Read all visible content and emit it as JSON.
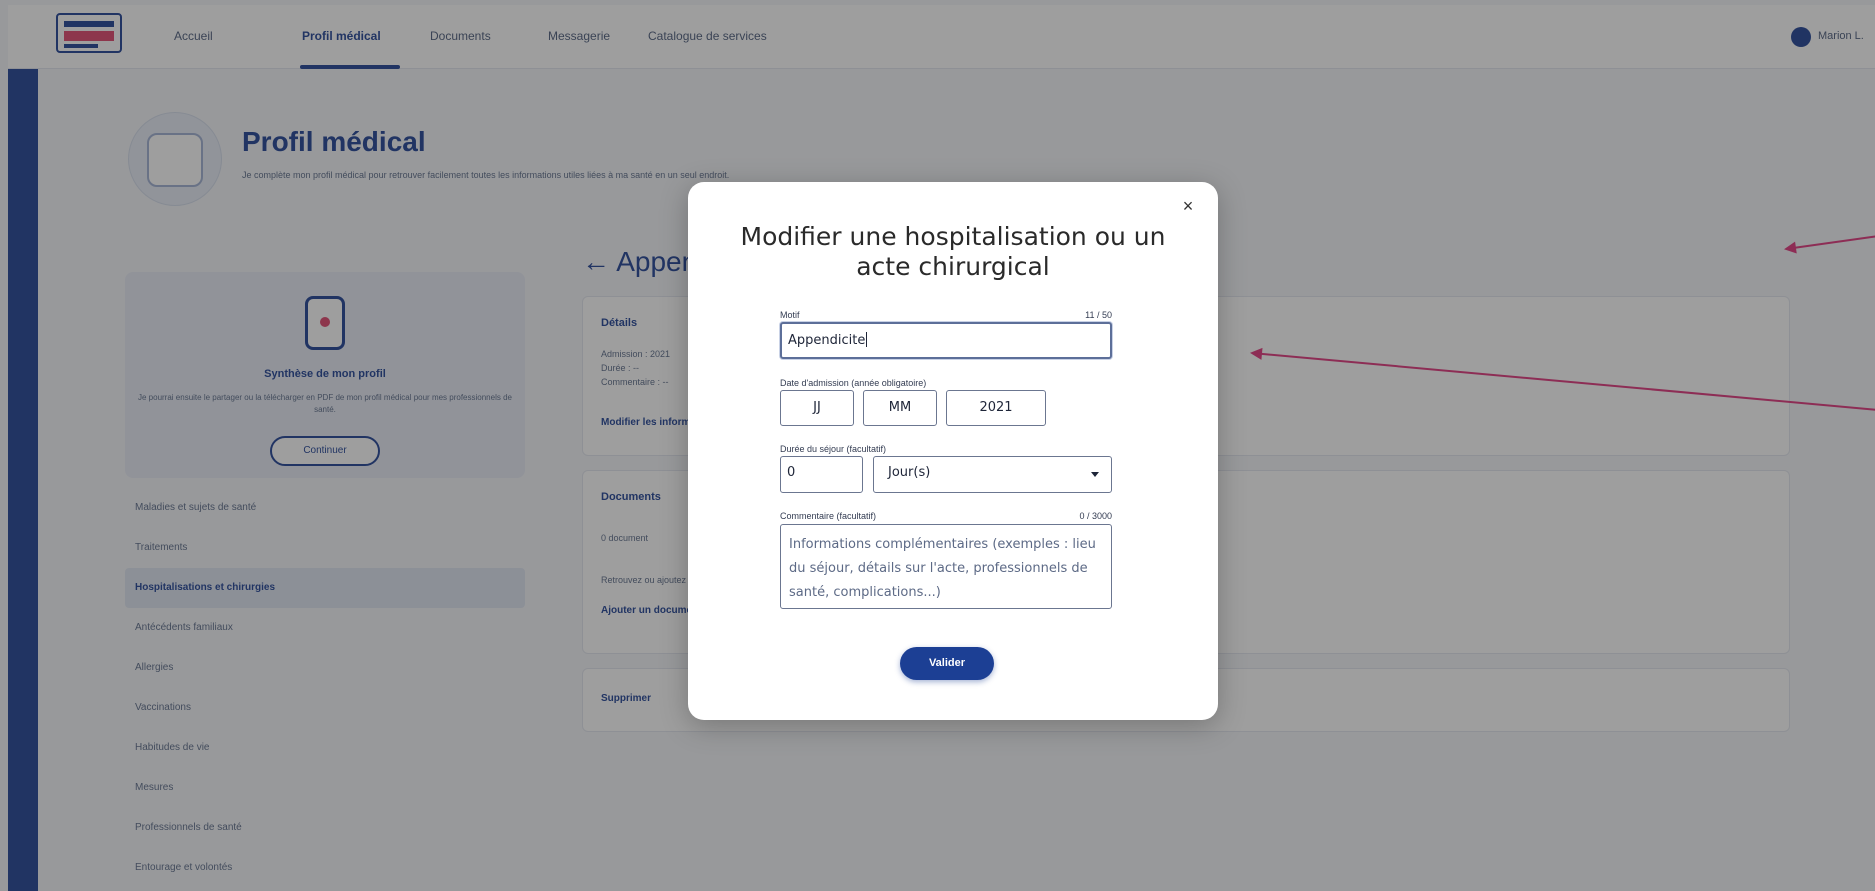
{
  "nav": {
    "items": [
      {
        "label": "Accueil",
        "active": false
      },
      {
        "label": "Profil médical",
        "active": true
      },
      {
        "label": "Documents",
        "active": false
      },
      {
        "label": "Messagerie",
        "active": false
      },
      {
        "label": "Catalogue de services",
        "active": false
      }
    ],
    "user_name": "Marion L."
  },
  "page": {
    "title": "Profil médical",
    "subtitle": "Je complète mon profil médical pour retrouver facilement toutes les informations utiles liées à ma santé en un seul endroit."
  },
  "profile_card": {
    "title": "Synthèse de mon profil",
    "text": "Je pourrai ensuite le partager ou la télécharger en PDF de mon profil médical pour mes professionnels de santé.",
    "button": "Continuer"
  },
  "sidebar": {
    "items": [
      {
        "label": "Maladies et sujets de santé",
        "active": false
      },
      {
        "label": "Traitements",
        "active": false
      },
      {
        "label": "Hospitalisations et chirurgies",
        "active": true
      },
      {
        "label": "Antécédents familiaux",
        "active": false
      },
      {
        "label": "Allergies",
        "active": false
      },
      {
        "label": "Vaccinations",
        "active": false
      },
      {
        "label": "Habitudes de vie",
        "active": false
      },
      {
        "label": "Mesures",
        "active": false
      },
      {
        "label": "Professionnels de santé",
        "active": false
      },
      {
        "label": "Entourage et volontés",
        "active": false
      }
    ]
  },
  "detail": {
    "back_title": "← Appendicite",
    "card1": {
      "title": "Détails",
      "lines": [
        "Admission : 2021",
        "Durée : --",
        "Commentaire : --"
      ],
      "link": "Modifier les informations"
    },
    "card2": {
      "title": "Documents",
      "doc": "0 document",
      "note": "Retrouvez ou ajoutez des documents liés à cet événement.",
      "link": "Ajouter un document"
    },
    "card3": {
      "link": "Supprimer"
    }
  },
  "modal": {
    "title": "Modifier une hospitalisation ou un acte chirurgical",
    "close_label": "×",
    "motif": {
      "label": "Motif",
      "counter": "11 / 50",
      "value": "Appendicite"
    },
    "date": {
      "label": "Date d'admission (année obligatoire)",
      "day_placeholder": "JJ",
      "month_placeholder": "MM",
      "year_value": "2021"
    },
    "duree": {
      "label": "Durée du séjour (facultatif)",
      "value": "0",
      "unit_selected": "Jour(s)"
    },
    "commentaire": {
      "label": "Commentaire (facultatif)",
      "counter": "0 / 3000",
      "placeholder": "Informations complémentaires (exemples : lieu du séjour, détails sur l'acte, professionnels de santé, complications...)"
    },
    "submit_label": "Valider"
  },
  "colors": {
    "primary": "#1c3f94",
    "accent": "#e0426b",
    "annotation_arrow": "#e0327a"
  }
}
